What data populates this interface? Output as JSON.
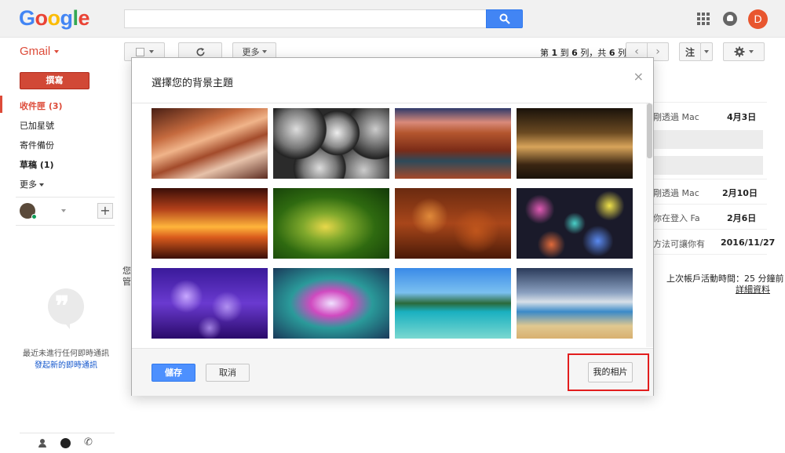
{
  "logo": "Google",
  "header": {
    "search_value": "",
    "account_initial": "D"
  },
  "toolbar": {
    "app_label": "Gmail",
    "more_label": "更多",
    "pager_prefix": "第",
    "pager_start": "1",
    "pager_to": "到",
    "pager_end": "6",
    "pager_unit": "列，共",
    "pager_total": "6",
    "pager_suffix": "列",
    "input_tool_label": "注"
  },
  "nav": {
    "compose_label": "撰寫",
    "items": [
      {
        "label": "收件匣 (3)"
      },
      {
        "label": "已加星號"
      },
      {
        "label": "寄件備份"
      },
      {
        "label": "草稿 (1)"
      },
      {
        "label": "更多"
      }
    ],
    "chat_empty": "最近未進行任何即時通訊",
    "chat_start": "發起新的即時通訊"
  },
  "mail_rows": [
    {
      "snippet": "剛透過 Mac",
      "date": "4月3日"
    },
    {
      "snippet": "剛透過 Mac",
      "date": "2月10日"
    },
    {
      "snippet": "你在登入 Fa",
      "date": "2月6日"
    },
    {
      "snippet": "方法可讓你有",
      "date": "2016/11/27"
    }
  ],
  "left_fragment": [
    "您",
    "管"
  ],
  "footer_activity": {
    "last_activity": "上次帳戶活動時間：25 分鐘前",
    "details": "詳細資料"
  },
  "dialog": {
    "title": "選擇您的背景主題",
    "close": "×",
    "save_label": "儲存",
    "cancel_label": "取消",
    "my_photos_label": "我的相片",
    "themes": [
      {
        "name": "canyon-waves"
      },
      {
        "name": "metal-pipes"
      },
      {
        "name": "river-canyon"
      },
      {
        "name": "chess-pieces"
      },
      {
        "name": "slot-canyon"
      },
      {
        "name": "caterpillar"
      },
      {
        "name": "autumn-leaves"
      },
      {
        "name": "bokeh-lights"
      },
      {
        "name": "jellyfish"
      },
      {
        "name": "colorful-water"
      },
      {
        "name": "tropical-lake"
      },
      {
        "name": "beach"
      }
    ]
  },
  "colors": {
    "brand_red": "#dd4b39",
    "primary_blue": "#4d90fe",
    "highlight": "#e21d1d"
  }
}
